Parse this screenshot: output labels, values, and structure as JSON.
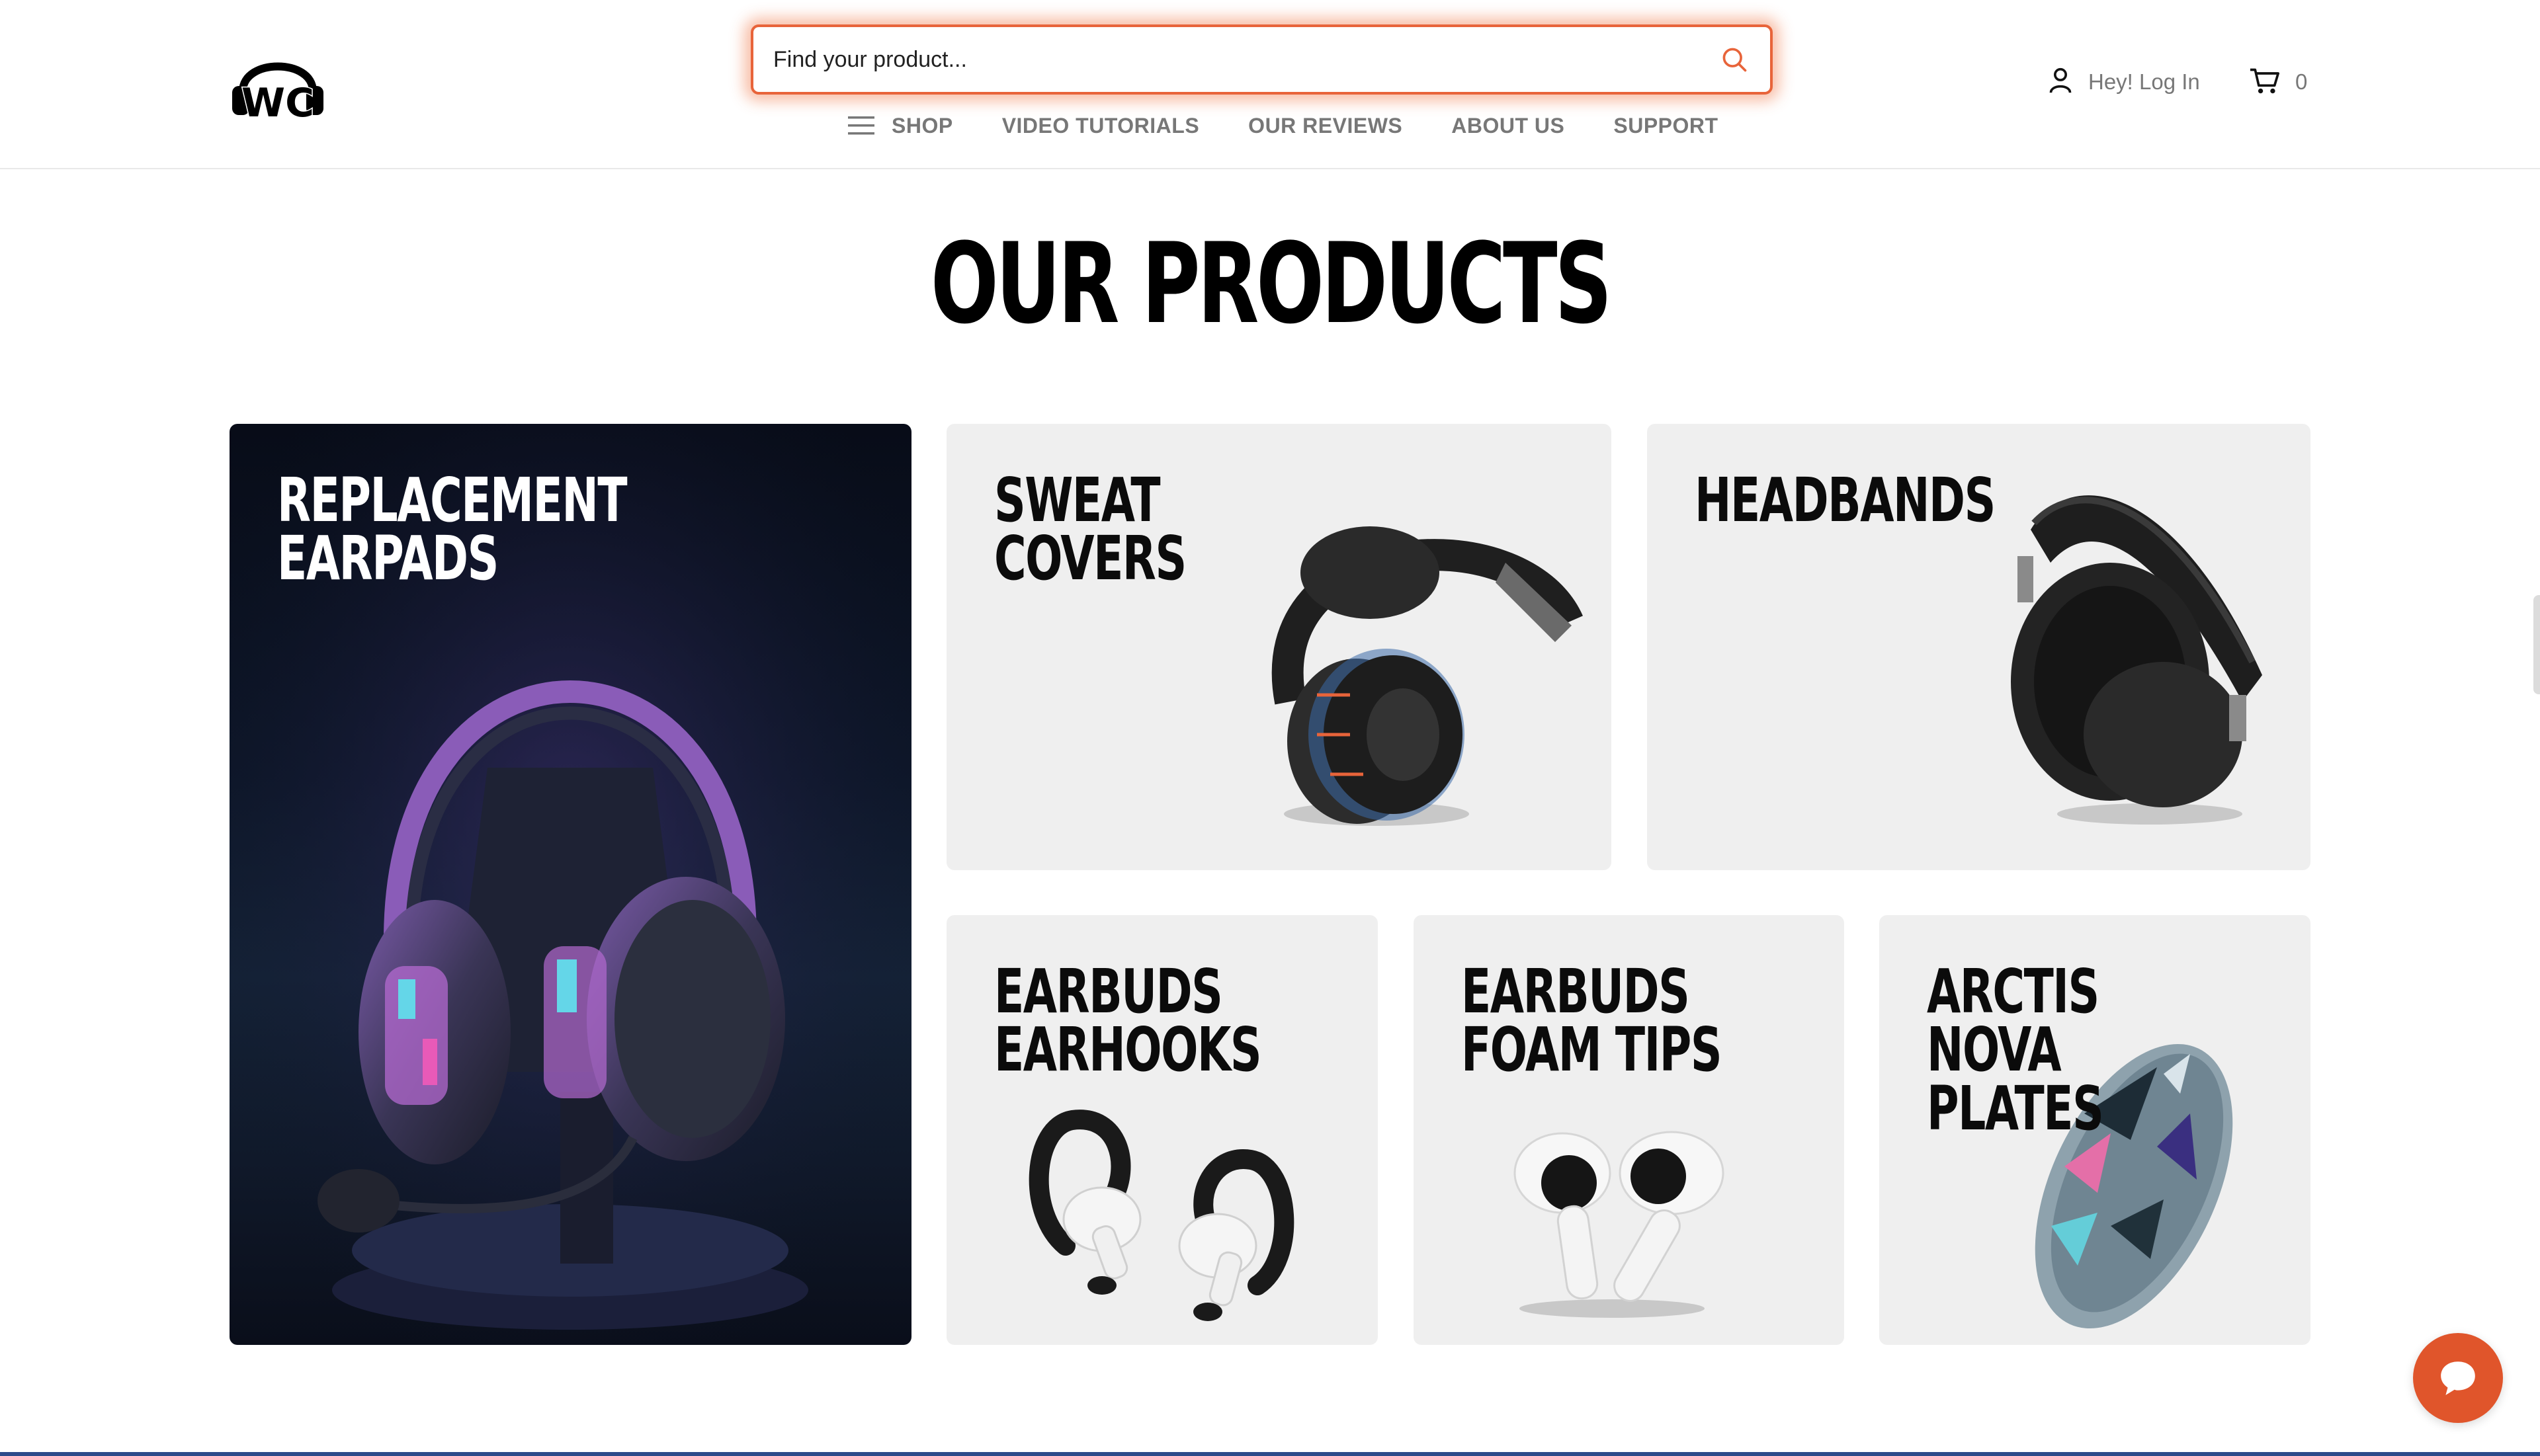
{
  "header": {
    "logo_alt": "WC",
    "search": {
      "placeholder": "Find your product...",
      "icon": "search-icon"
    },
    "nav": [
      {
        "label": "SHOP",
        "icon": "menu-icon"
      },
      {
        "label": "VIDEO TUTORIALS"
      },
      {
        "label": "OUR REVIEWS"
      },
      {
        "label": "ABOUT US"
      },
      {
        "label": "SUPPORT"
      }
    ],
    "account": {
      "label": "Hey! Log In",
      "icon": "user-icon"
    },
    "cart": {
      "count": "0",
      "icon": "cart-icon"
    }
  },
  "main": {
    "title": "OUR PRODUCTS",
    "cards": [
      {
        "label": "REPLACEMENT\nEARPADS"
      },
      {
        "label": "SWEAT\nCOVERS"
      },
      {
        "label": "HEADBANDS"
      },
      {
        "label": "EARBUDS\nEARHOOKS"
      },
      {
        "label": "EARBUDS\nFOAM TIPS"
      },
      {
        "label": "ARCTIS NOVA\nPLATES"
      }
    ]
  },
  "chat": {
    "icon": "chat-bubble-icon"
  },
  "colors": {
    "accent": "#e8643a",
    "chat": "#e0552b",
    "card_bg": "#efefef",
    "dark_card_bg": "#0e1320",
    "nav_text": "#777777"
  }
}
